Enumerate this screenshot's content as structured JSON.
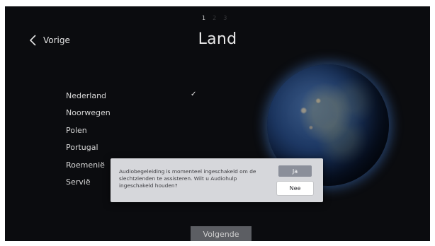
{
  "header": {
    "back_label": "Vorige",
    "title": "Land",
    "steps": [
      "1",
      "2",
      "3"
    ],
    "active_step": 1
  },
  "countries": {
    "items": [
      {
        "label": "Nederland",
        "selected": true
      },
      {
        "label": "Noorwegen",
        "selected": false
      },
      {
        "label": "Polen",
        "selected": false
      },
      {
        "label": "Portugal",
        "selected": false
      },
      {
        "label": "Roemenië",
        "selected": false
      },
      {
        "label": "Servië",
        "selected": false
      }
    ],
    "check_glyph": "✓"
  },
  "dialog": {
    "message": "Audiobegeleiding is momenteel ingeschakeld om de slechtzienden te assisteren. Wilt u Audiohulp ingeschakeld houden?",
    "yes_label": "Ja",
    "no_label": "Nee"
  },
  "footer": {
    "next_label": "Volgende"
  },
  "icons": {
    "back": "chevron-left-icon",
    "check": "checkmark-icon",
    "globe": "earth-globe-icon"
  },
  "colors": {
    "background": "#0b0c0f",
    "text": "#e8e8e8",
    "dialog_bg": "#d6d7db",
    "yes_button": "#8b8f9a",
    "next_button": "#5c5e63"
  }
}
